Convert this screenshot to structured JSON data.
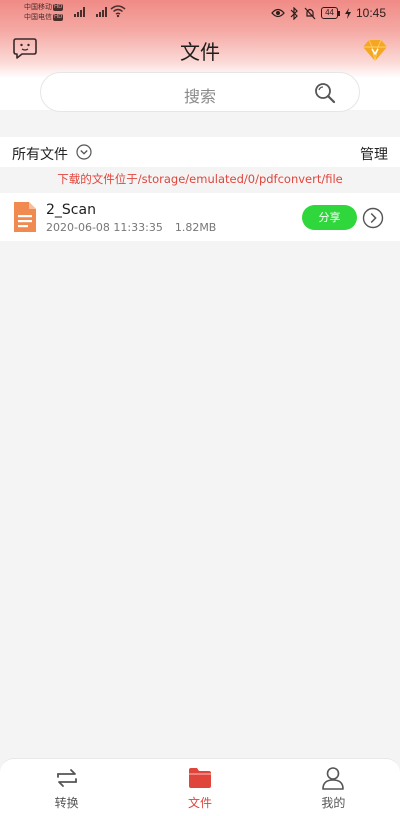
{
  "status_bar": {
    "carrier1": "中国移动",
    "carrier2": "中国电信",
    "hd_badge": "HD",
    "battery": "44",
    "time": "10:45"
  },
  "header": {
    "title": "文件",
    "feedback_icon": "chat-bubble-face-icon",
    "vip_icon": "diamond-vip-icon"
  },
  "search": {
    "placeholder": "搜索",
    "icon": "search-icon"
  },
  "filter": {
    "label": "所有文件",
    "manage": "管理"
  },
  "path_note": "下载的文件位于/storage/emulated/0/pdfconvert/file",
  "files": [
    {
      "name": "2_Scan",
      "date": "2020-06-08 11:33:35",
      "size": "1.82MB",
      "share_label": "分享"
    }
  ],
  "bottom_nav": [
    {
      "label": "转换",
      "icon": "convert-arrows-icon",
      "active": false
    },
    {
      "label": "文件",
      "icon": "folder-icon",
      "active": true
    },
    {
      "label": "我的",
      "icon": "person-icon",
      "active": false
    }
  ],
  "colors": {
    "header_top": "#f08a86",
    "accent_red": "#e0453c",
    "share_green": "#2fd63c",
    "background": "#f4f4f4"
  }
}
